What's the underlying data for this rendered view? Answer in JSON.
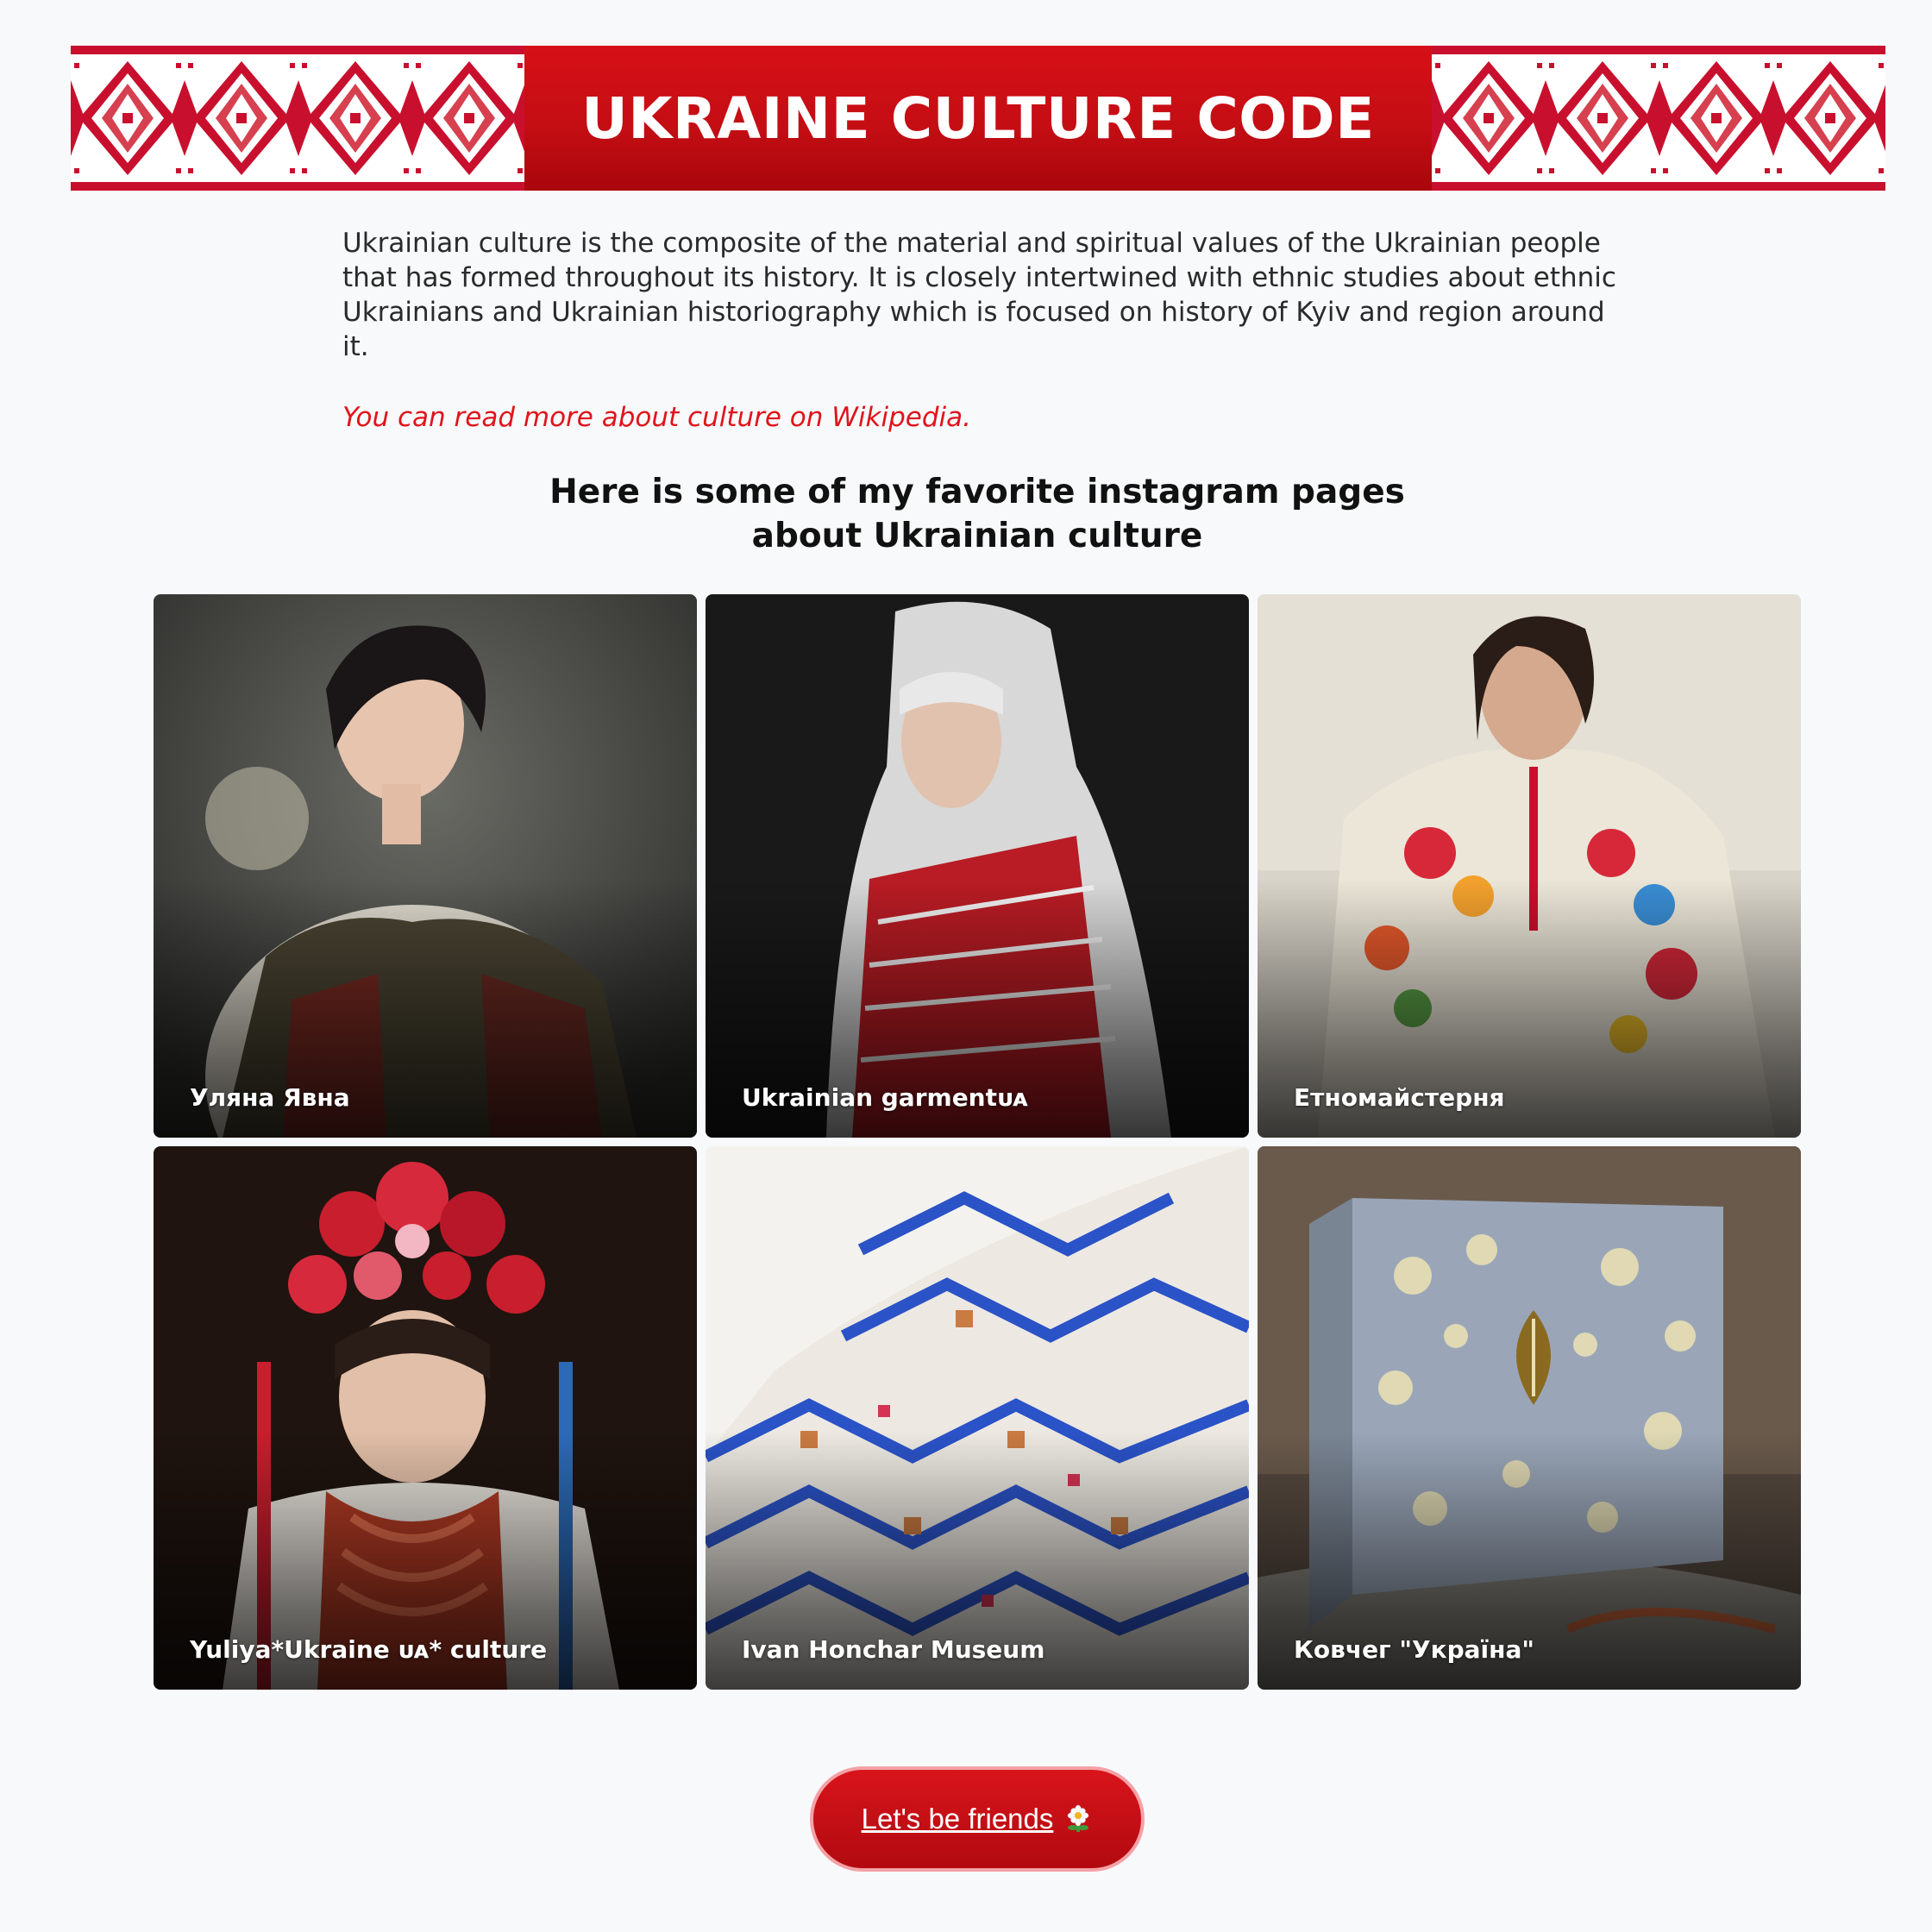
{
  "header": {
    "title": "UKRAINE CULTURE CODE",
    "ornament_colors": [
      "#c8102e",
      "#ffffff"
    ]
  },
  "intro": {
    "paragraph": "Ukrainian culture is the composite of the material and spiritual values of the Ukrainian people that has formed throughout its history. It is closely intertwined with ethnic studies about ethnic Ukrainians and Ukrainian historiography which is focused on history of Kyiv and region around it.",
    "wiki_link": "You can read more about culture on Wikipedia."
  },
  "favorites": {
    "heading_line1": "Here is some of my favorite instagram pages",
    "heading_line2": "about Ukrainian culture",
    "cards": [
      {
        "label": "Уляна Явна"
      },
      {
        "label": "Ukrainian garmentᴜᴀ"
      },
      {
        "label": "Етномайстерня"
      },
      {
        "label": "Yuliya*Ukraine ᴜᴀ* culture"
      },
      {
        "label": "Ivan Honchar Museum"
      },
      {
        "label": "Ковчег \"Україна\""
      }
    ]
  },
  "footer": {
    "button_label": "Let's be friends",
    "button_icon": "flower-icon"
  },
  "colors": {
    "accent_red": "#d0121a",
    "link_red": "#e0141b",
    "background": "#f8f9fb"
  }
}
